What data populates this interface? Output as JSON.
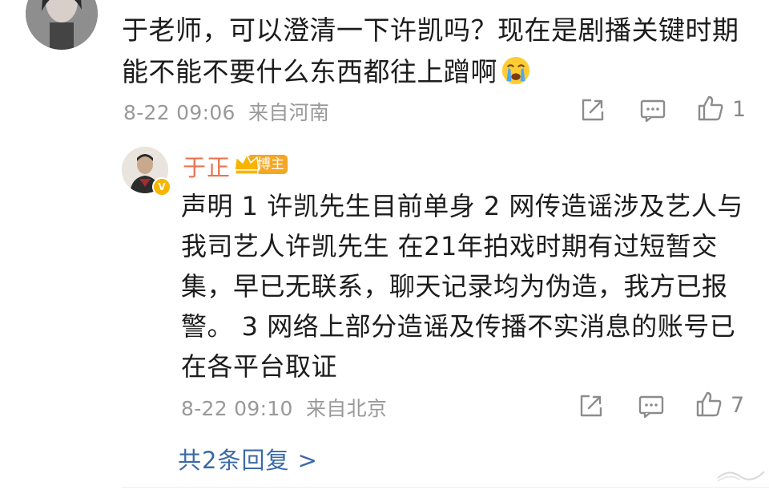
{
  "comment": {
    "avatar_icon": "user-avatar",
    "line1": "于老师，可以澄清一下许凯吗？现在是剧播关键时期",
    "line2": "能不能不要什么东西都往上蹭啊",
    "emoji": "crying-face-emoji",
    "date": "8-22 09:06",
    "source": "来自河南",
    "like_count": "1",
    "actions": [
      "share-icon",
      "comment-icon",
      "like-icon"
    ]
  },
  "reply": {
    "author": "于正",
    "badge_label": "博主",
    "badge_icon": "crown-icon",
    "verified_icon": "verified-v-icon",
    "lines": [
      "声明 1 许凯先生目前单身 2 网传造谣涉及艺人与",
      "我司艺人许凯先生 在21年拍戏时期有过短暂交",
      "集，早已无联系，聊天记录均为伪造，我方已报",
      "警。 3 网络上部分造谣及传播不实消息的账号已",
      "在各平台取证"
    ],
    "date": "8-22 09:10",
    "source": "来自北京",
    "like_count": "7",
    "actions": [
      "share-icon",
      "comment-icon",
      "like-icon"
    ]
  },
  "more_replies": "共2条回复 >",
  "colors": {
    "name": "#eb7350",
    "link": "#3a6aa6",
    "meta": "#999999",
    "badge": "#f7b500"
  }
}
